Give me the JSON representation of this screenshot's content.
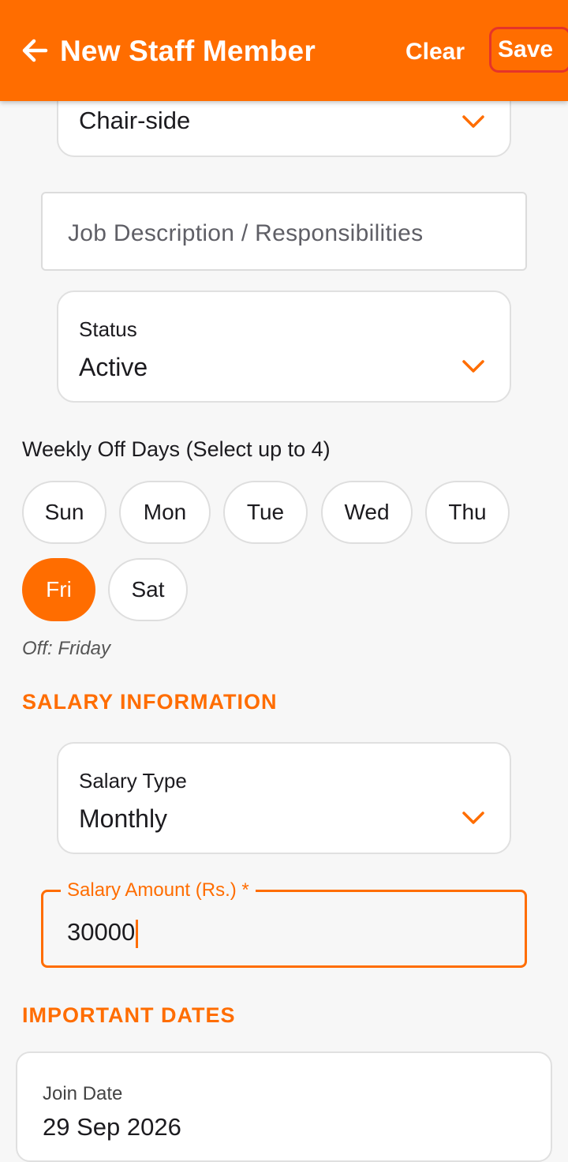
{
  "header": {
    "title": "New Staff Member",
    "clear_label": "Clear",
    "save_label": "Save",
    "back_icon": "arrow-left-icon",
    "color": "#ff6d00"
  },
  "role_dropdown": {
    "value": "Chair-side"
  },
  "job_description": {
    "placeholder": "Job Description / Responsibilities"
  },
  "status_dropdown": {
    "label": "Status",
    "value": "Active"
  },
  "weekly_off": {
    "title": "Weekly Off Days (Select up to 4)",
    "days": [
      {
        "label": "Sun",
        "selected": false
      },
      {
        "label": "Mon",
        "selected": false
      },
      {
        "label": "Tue",
        "selected": false
      },
      {
        "label": "Wed",
        "selected": false
      },
      {
        "label": "Thu",
        "selected": false
      },
      {
        "label": "Fri",
        "selected": true
      },
      {
        "label": "Sat",
        "selected": false
      }
    ],
    "summary": "Off: Friday"
  },
  "salary_section": {
    "title": "SALARY INFORMATION",
    "type_label": "Salary Type",
    "type_value": "Monthly",
    "amount_label": "Salary Amount (Rs.) *",
    "amount_value": "30000"
  },
  "dates_section": {
    "title": "IMPORTANT DATES",
    "join_label": "Join Date",
    "join_value": "29 Sep 2026"
  },
  "colors": {
    "accent": "#ff6d00",
    "save_outline": "#e5342a",
    "background": "#f7f7f7"
  }
}
